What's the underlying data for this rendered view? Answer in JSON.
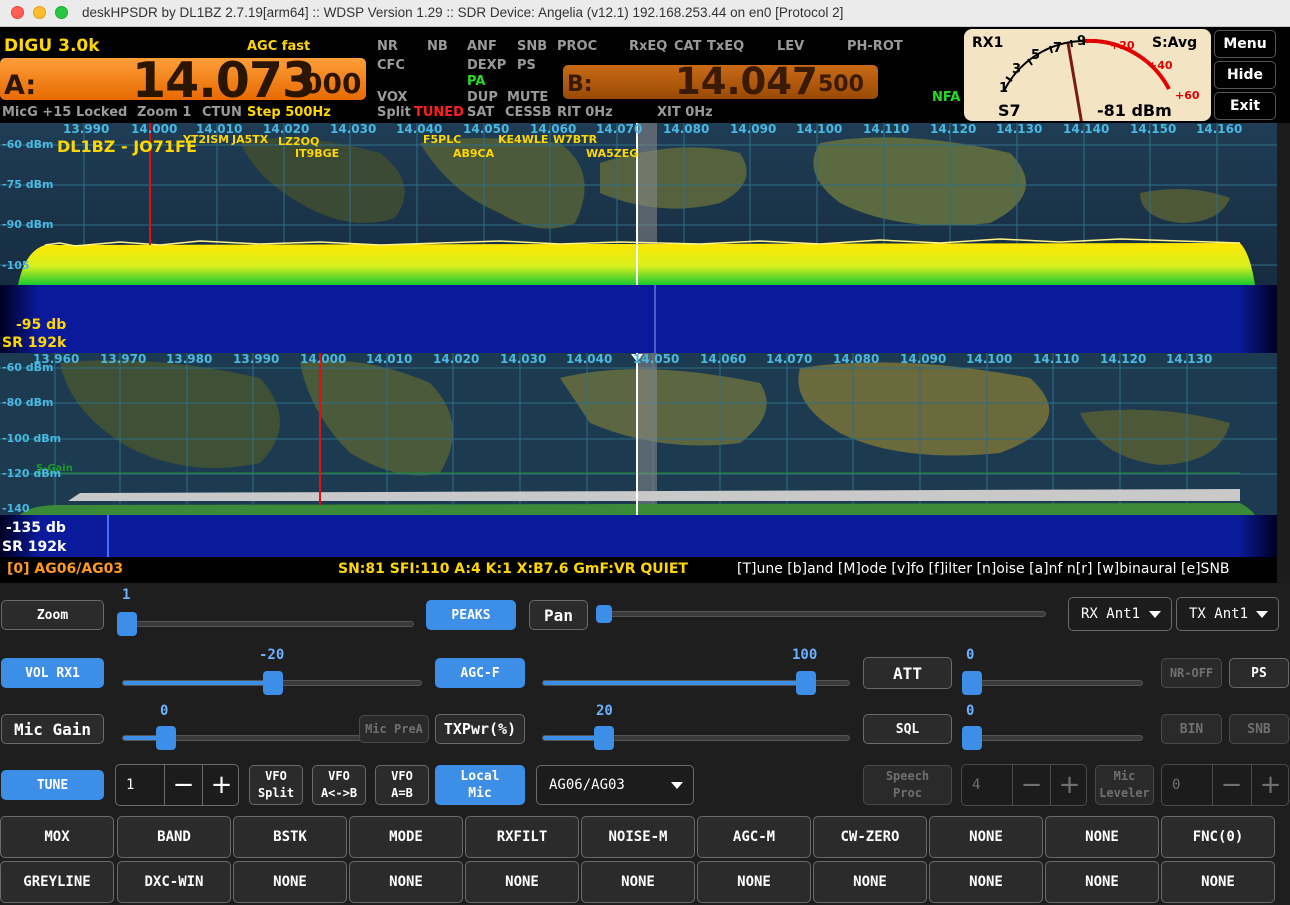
{
  "window": {
    "title": "deskHPSDR by DL1BZ 2.7.19[arm64] :: WDSP Version 1.29 :: SDR Device: Angelia (v12.1) 192.168.253.44 on en0 [Protocol 2]"
  },
  "vfo": {
    "mode": "DIGU 3.0k",
    "agc": "AGC fast",
    "a_label": "A:",
    "a_freq_main": "14.073",
    "a_freq_sub": "000",
    "b_label": "B:",
    "b_freq_main": "14.047",
    "b_freq_sub": "500",
    "mic": "MicG +15",
    "locked": "Locked",
    "zoom": "Zoom 1",
    "ctun": "CTUN",
    "step": "Step 500Hz",
    "nfa": "NFA",
    "status": {
      "nr": "NR",
      "nb": "NB",
      "anf": "ANF",
      "snb": "SNB",
      "proc": "PROC",
      "rxeq": "RxEQ",
      "cat": "CAT",
      "txeq": "TxEQ",
      "lev": "LEV",
      "phrot": "PH-ROT",
      "cfc": "CFC",
      "dexp": "DEXP",
      "ps": "PS",
      "pa": "PA",
      "vox": "VOX",
      "dup": "DUP",
      "mute": "MUTE",
      "split": "Split",
      "tuned": "TUNED",
      "sat": "SAT",
      "cessb": "CESSB",
      "rit": "RIT 0Hz",
      "xit": "XIT 0Hz"
    }
  },
  "meter": {
    "rx": "RX1",
    "mode": "S:Avg",
    "s_reading": "S7",
    "dbm": "-81 dBm",
    "scale": [
      "1",
      "3",
      "5",
      "7",
      "9",
      "+20",
      "+40",
      "+60"
    ],
    "needle_s_units": 7.5
  },
  "side_buttons": {
    "menu": "Menu",
    "hide": "Hide",
    "exit": "Exit"
  },
  "panadapter1": {
    "ticks": [
      "13.990",
      "14.000",
      "14.010",
      "14.020",
      "14.030",
      "14.040",
      "14.050",
      "14.060",
      "14.070",
      "14.080",
      "14.090",
      "14.100",
      "14.110",
      "14.120",
      "14.130",
      "14.140",
      "14.150",
      "14.160"
    ],
    "dbm": [
      "-60 dBm",
      "-75 dBm",
      "-90 dBm",
      "-105"
    ],
    "callsign": "DL1BZ - JO71FE",
    "spots": [
      "YT2ISM",
      "JA5TX",
      "LZ2OQ",
      "IT9BGE",
      "F5PLC",
      "AB9CA",
      "KE4WLE",
      "W7BTR",
      "WA5ZEG"
    ],
    "wf_db": "-95 db",
    "wf_sr": "SR 192k"
  },
  "panadapter2": {
    "ticks": [
      "13.960",
      "13.970",
      "13.980",
      "13.990",
      "14.000",
      "14.010",
      "14.020",
      "14.030",
      "14.040",
      "14.050",
      "14.060",
      "14.070",
      "14.080",
      "14.090",
      "14.100",
      "14.110",
      "14.120",
      "14.130"
    ],
    "dbm": [
      "-60 dBm",
      "-80 dBm",
      "-100 dBm",
      "-120 dBm",
      "-140"
    ],
    "gain": "S-Gain",
    "wf_db": "-135 db",
    "wf_sr": "SR 192k"
  },
  "infobar": {
    "memory": "[0] AG06/AG03",
    "solar": "SN:81 SFI:110 A:4 K:1 X:B7.6 GmF:VR QUIET",
    "shortcuts": "[T]une [b]and [M]ode [v]fo [f]ilter [n]oise [a]nf n[r] [w]binaural [e]SNB"
  },
  "controls": {
    "zoom": "Zoom",
    "zoom_val": "1",
    "zoom_level": 1,
    "peaks": "PEAKS",
    "pan": "Pan",
    "pan_level": 0,
    "rx_ant": "RX Ant1",
    "tx_ant": "TX Ant1",
    "vol": "VOL RX1",
    "vol_val": "-20",
    "agc": "AGC-F",
    "agc_val": "100",
    "att": "ATT",
    "att_val": "0",
    "nr_off": "NR-OFF",
    "ps": "PS",
    "mic_gain": "Mic Gain",
    "mic_val": "0",
    "mic_prea": "Mic PreA",
    "txpwr": "TXPwr(%)",
    "txpwr_val": "20",
    "sql": "SQL",
    "sql_val": "0",
    "bin": "BIN",
    "snb": "SNB",
    "tune": "TUNE",
    "tune_spin": "1",
    "vfo_split": "VFO\nSplit",
    "vfo_ab": "VFO\nA<->B",
    "vfo_aeqb": "VFO\nA=B",
    "local_mic": "Local\nMic",
    "audio_dev": "AG06/AG03",
    "speech_proc": "Speech\nProc",
    "speech_val": "4",
    "mic_leveler": "Mic\nLeveler",
    "leveler_val": "0",
    "minus": "−",
    "plus": "+"
  },
  "func_row1": [
    "MOX",
    "BAND",
    "BSTK",
    "MODE",
    "RXFILT",
    "NOISE-M",
    "AGC-M",
    "CW-ZERO",
    "NONE",
    "NONE",
    "FNC(0)"
  ],
  "func_row2": [
    "GREYLINE",
    "DXC-WIN",
    "NONE",
    "NONE",
    "NONE",
    "NONE",
    "NONE",
    "NONE",
    "NONE",
    "NONE",
    "NONE"
  ],
  "colors": {
    "accent": "#3d8ee6",
    "vfo_a": "#f07a10",
    "agc": "#ffd700",
    "tuned": "#ff2020",
    "spectrum": "#f5e000",
    "waterfall": "#0a1a9a"
  }
}
